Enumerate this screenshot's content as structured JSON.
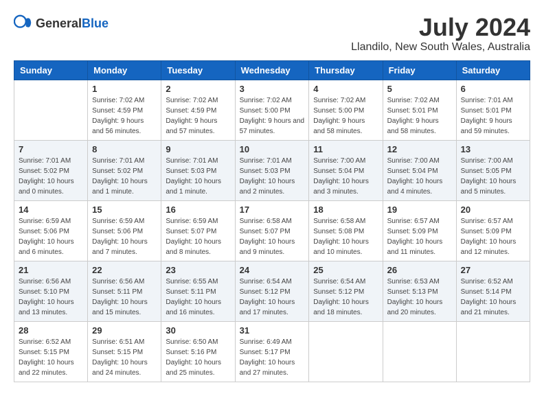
{
  "header": {
    "logo_general": "General",
    "logo_blue": "Blue",
    "month_title": "July 2024",
    "location": "Llandilo, New South Wales, Australia"
  },
  "days_of_week": [
    "Sunday",
    "Monday",
    "Tuesday",
    "Wednesday",
    "Thursday",
    "Friday",
    "Saturday"
  ],
  "weeks": [
    [
      {
        "day": "",
        "sunrise": "",
        "sunset": "",
        "daylight": ""
      },
      {
        "day": "1",
        "sunrise": "Sunrise: 7:02 AM",
        "sunset": "Sunset: 4:59 PM",
        "daylight": "Daylight: 9 hours and 56 minutes."
      },
      {
        "day": "2",
        "sunrise": "Sunrise: 7:02 AM",
        "sunset": "Sunset: 4:59 PM",
        "daylight": "Daylight: 9 hours and 57 minutes."
      },
      {
        "day": "3",
        "sunrise": "Sunrise: 7:02 AM",
        "sunset": "Sunset: 5:00 PM",
        "daylight": "Daylight: 9 hours and 57 minutes."
      },
      {
        "day": "4",
        "sunrise": "Sunrise: 7:02 AM",
        "sunset": "Sunset: 5:00 PM",
        "daylight": "Daylight: 9 hours and 58 minutes."
      },
      {
        "day": "5",
        "sunrise": "Sunrise: 7:02 AM",
        "sunset": "Sunset: 5:01 PM",
        "daylight": "Daylight: 9 hours and 58 minutes."
      },
      {
        "day": "6",
        "sunrise": "Sunrise: 7:01 AM",
        "sunset": "Sunset: 5:01 PM",
        "daylight": "Daylight: 9 hours and 59 minutes."
      }
    ],
    [
      {
        "day": "7",
        "sunrise": "Sunrise: 7:01 AM",
        "sunset": "Sunset: 5:02 PM",
        "daylight": "Daylight: 10 hours and 0 minutes."
      },
      {
        "day": "8",
        "sunrise": "Sunrise: 7:01 AM",
        "sunset": "Sunset: 5:02 PM",
        "daylight": "Daylight: 10 hours and 1 minute."
      },
      {
        "day": "9",
        "sunrise": "Sunrise: 7:01 AM",
        "sunset": "Sunset: 5:03 PM",
        "daylight": "Daylight: 10 hours and 1 minute."
      },
      {
        "day": "10",
        "sunrise": "Sunrise: 7:01 AM",
        "sunset": "Sunset: 5:03 PM",
        "daylight": "Daylight: 10 hours and 2 minutes."
      },
      {
        "day": "11",
        "sunrise": "Sunrise: 7:00 AM",
        "sunset": "Sunset: 5:04 PM",
        "daylight": "Daylight: 10 hours and 3 minutes."
      },
      {
        "day": "12",
        "sunrise": "Sunrise: 7:00 AM",
        "sunset": "Sunset: 5:04 PM",
        "daylight": "Daylight: 10 hours and 4 minutes."
      },
      {
        "day": "13",
        "sunrise": "Sunrise: 7:00 AM",
        "sunset": "Sunset: 5:05 PM",
        "daylight": "Daylight: 10 hours and 5 minutes."
      }
    ],
    [
      {
        "day": "14",
        "sunrise": "Sunrise: 6:59 AM",
        "sunset": "Sunset: 5:06 PM",
        "daylight": "Daylight: 10 hours and 6 minutes."
      },
      {
        "day": "15",
        "sunrise": "Sunrise: 6:59 AM",
        "sunset": "Sunset: 5:06 PM",
        "daylight": "Daylight: 10 hours and 7 minutes."
      },
      {
        "day": "16",
        "sunrise": "Sunrise: 6:59 AM",
        "sunset": "Sunset: 5:07 PM",
        "daylight": "Daylight: 10 hours and 8 minutes."
      },
      {
        "day": "17",
        "sunrise": "Sunrise: 6:58 AM",
        "sunset": "Sunset: 5:07 PM",
        "daylight": "Daylight: 10 hours and 9 minutes."
      },
      {
        "day": "18",
        "sunrise": "Sunrise: 6:58 AM",
        "sunset": "Sunset: 5:08 PM",
        "daylight": "Daylight: 10 hours and 10 minutes."
      },
      {
        "day": "19",
        "sunrise": "Sunrise: 6:57 AM",
        "sunset": "Sunset: 5:09 PM",
        "daylight": "Daylight: 10 hours and 11 minutes."
      },
      {
        "day": "20",
        "sunrise": "Sunrise: 6:57 AM",
        "sunset": "Sunset: 5:09 PM",
        "daylight": "Daylight: 10 hours and 12 minutes."
      }
    ],
    [
      {
        "day": "21",
        "sunrise": "Sunrise: 6:56 AM",
        "sunset": "Sunset: 5:10 PM",
        "daylight": "Daylight: 10 hours and 13 minutes."
      },
      {
        "day": "22",
        "sunrise": "Sunrise: 6:56 AM",
        "sunset": "Sunset: 5:11 PM",
        "daylight": "Daylight: 10 hours and 15 minutes."
      },
      {
        "day": "23",
        "sunrise": "Sunrise: 6:55 AM",
        "sunset": "Sunset: 5:11 PM",
        "daylight": "Daylight: 10 hours and 16 minutes."
      },
      {
        "day": "24",
        "sunrise": "Sunrise: 6:54 AM",
        "sunset": "Sunset: 5:12 PM",
        "daylight": "Daylight: 10 hours and 17 minutes."
      },
      {
        "day": "25",
        "sunrise": "Sunrise: 6:54 AM",
        "sunset": "Sunset: 5:12 PM",
        "daylight": "Daylight: 10 hours and 18 minutes."
      },
      {
        "day": "26",
        "sunrise": "Sunrise: 6:53 AM",
        "sunset": "Sunset: 5:13 PM",
        "daylight": "Daylight: 10 hours and 20 minutes."
      },
      {
        "day": "27",
        "sunrise": "Sunrise: 6:52 AM",
        "sunset": "Sunset: 5:14 PM",
        "daylight": "Daylight: 10 hours and 21 minutes."
      }
    ],
    [
      {
        "day": "28",
        "sunrise": "Sunrise: 6:52 AM",
        "sunset": "Sunset: 5:15 PM",
        "daylight": "Daylight: 10 hours and 22 minutes."
      },
      {
        "day": "29",
        "sunrise": "Sunrise: 6:51 AM",
        "sunset": "Sunset: 5:15 PM",
        "daylight": "Daylight: 10 hours and 24 minutes."
      },
      {
        "day": "30",
        "sunrise": "Sunrise: 6:50 AM",
        "sunset": "Sunset: 5:16 PM",
        "daylight": "Daylight: 10 hours and 25 minutes."
      },
      {
        "day": "31",
        "sunrise": "Sunrise: 6:49 AM",
        "sunset": "Sunset: 5:17 PM",
        "daylight": "Daylight: 10 hours and 27 minutes."
      },
      {
        "day": "",
        "sunrise": "",
        "sunset": "",
        "daylight": ""
      },
      {
        "day": "",
        "sunrise": "",
        "sunset": "",
        "daylight": ""
      },
      {
        "day": "",
        "sunrise": "",
        "sunset": "",
        "daylight": ""
      }
    ]
  ]
}
